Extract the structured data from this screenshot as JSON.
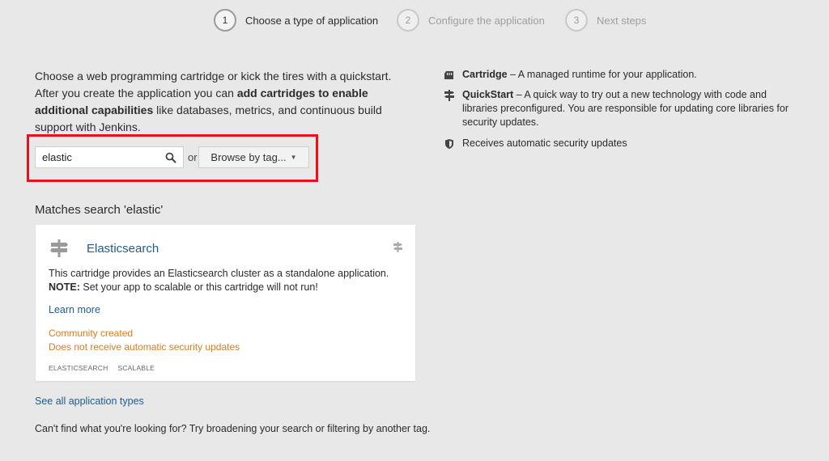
{
  "wizard": {
    "steps": [
      {
        "number": "1",
        "label": "Choose a type of application",
        "active": true
      },
      {
        "number": "2",
        "label": "Configure the application",
        "active": false
      },
      {
        "number": "3",
        "label": "Next steps",
        "active": false
      }
    ]
  },
  "intro": {
    "part1": "Choose a web programming cartridge or kick the tires with a quickstart. After you create the application you can ",
    "bold": "add cartridges to enable additional capabilities",
    "part2": " like databases, metrics, and continuous build support with Jenkins."
  },
  "search": {
    "value": "elastic",
    "icon": "search-icon",
    "or_label": "or",
    "browse_label": "Browse by tag..."
  },
  "results": {
    "heading": "Matches search 'elastic'",
    "card": {
      "title": "Elasticsearch",
      "description": "This cartridge provides an Elasticsearch cluster as a standalone application.",
      "note_label": "NOTE:",
      "note_text": " Set your app to scalable or this cartridge will not run!",
      "learn_more": "Learn more",
      "community": "Community created",
      "security": "Does not receive automatic security updates",
      "tags": [
        "ELASTICSEARCH",
        "SCALABLE"
      ]
    },
    "see_all": "See all application types",
    "cant_find": "Can't find what you're looking for? Try broadening your search or filtering by another tag."
  },
  "legend": {
    "cartridge_title": "Cartridge",
    "cartridge_text": " – A managed runtime for your application.",
    "quickstart_title": "QuickStart",
    "quickstart_text": " – A quick way to try out a new technology with code and libraries preconfigured. You are responsible for updating core libraries for security updates.",
    "security_text": "Receives automatic security updates"
  },
  "colors": {
    "link": "#1e5c8f",
    "warning": "#e07b1a",
    "highlight": "#e8111a",
    "background": "#e8e8e8"
  }
}
